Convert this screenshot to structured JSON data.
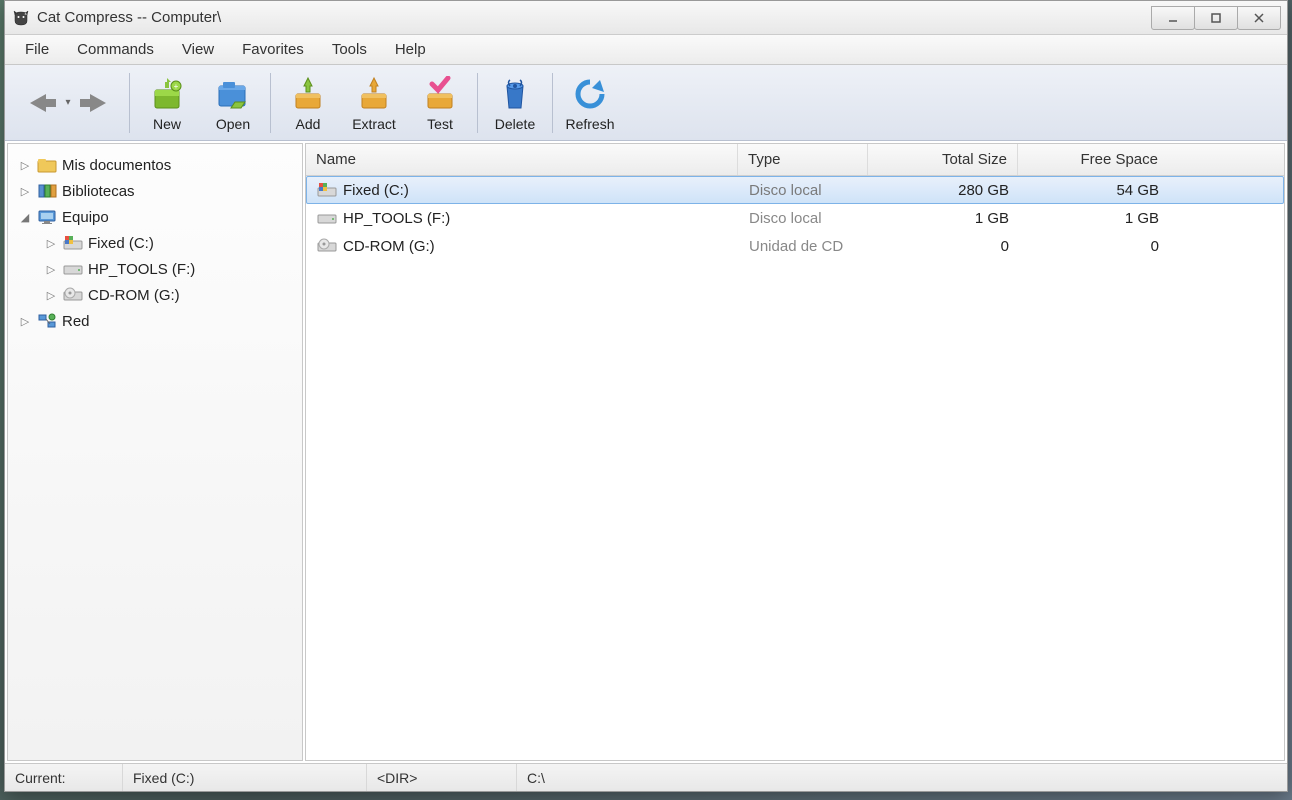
{
  "window": {
    "title": "Cat Compress -- Computer\\"
  },
  "menu": {
    "items": [
      "File",
      "Commands",
      "View",
      "Favorites",
      "Tools",
      "Help"
    ]
  },
  "toolbar": {
    "new": "New",
    "open": "Open",
    "add": "Add",
    "extract": "Extract",
    "test": "Test",
    "delete": "Delete",
    "refresh": "Refresh"
  },
  "tree": {
    "items": [
      {
        "label": "Mis documentos",
        "level": 1,
        "expander": "▷",
        "icon": "folder"
      },
      {
        "label": "Bibliotecas",
        "level": 1,
        "expander": "▷",
        "icon": "libraries"
      },
      {
        "label": "Equipo",
        "level": 1,
        "expander": "◢",
        "icon": "computer"
      },
      {
        "label": "Fixed (C:)",
        "level": 2,
        "expander": "▷",
        "icon": "drive-win"
      },
      {
        "label": "HP_TOOLS (F:)",
        "level": 2,
        "expander": "▷",
        "icon": "drive"
      },
      {
        "label": "CD-ROM (G:)",
        "level": 2,
        "expander": "▷",
        "icon": "cdrom"
      },
      {
        "label": "Red",
        "level": 1,
        "expander": "▷",
        "icon": "network"
      }
    ]
  },
  "list": {
    "headers": {
      "name": "Name",
      "type": "Type",
      "size": "Total Size",
      "free": "Free Space"
    },
    "rows": [
      {
        "name": "Fixed (C:)",
        "type": "Disco local",
        "size": "280 GB",
        "free": "54 GB",
        "icon": "drive-win",
        "selected": true
      },
      {
        "name": "HP_TOOLS (F:)",
        "type": "Disco local",
        "size": "1 GB",
        "free": "1 GB",
        "icon": "drive",
        "selected": false
      },
      {
        "name": "CD-ROM (G:)",
        "type": "Unidad de CD",
        "size": "0",
        "free": "0",
        "icon": "cdrom",
        "selected": false
      }
    ]
  },
  "status": {
    "label": "Current:",
    "item": "Fixed (C:)",
    "dir": "<DIR>",
    "path": "C:\\"
  }
}
